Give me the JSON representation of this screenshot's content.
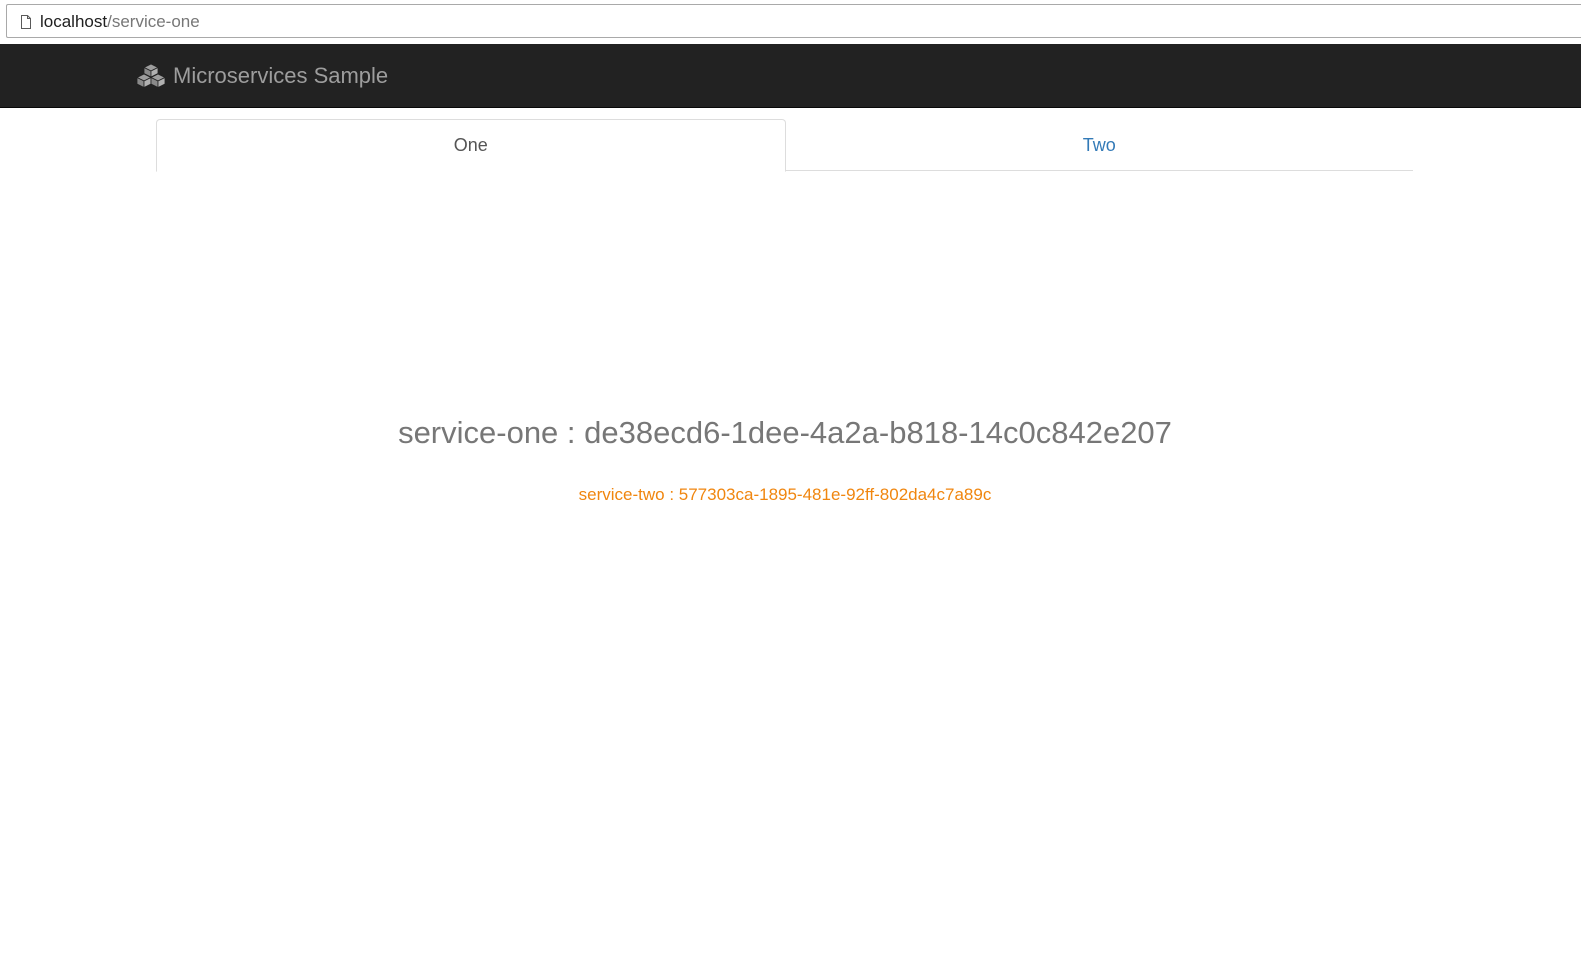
{
  "browser": {
    "url_host": "localhost",
    "url_path": "/service-one",
    "page_icon": "page-icon"
  },
  "navbar": {
    "brand_icon": "cubes-icon",
    "brand": "Microservices Sample",
    "background": "#222222"
  },
  "tabs": [
    {
      "label": "One",
      "active": true
    },
    {
      "label": "Two",
      "active": false
    }
  ],
  "content": {
    "service_one": "service-one : de38ecd6-1dee-4a2a-b818-14c0c842e207",
    "service_two": "service-two : 577303ca-1895-481e-92ff-802da4c7a89c",
    "service_two_color": "#f0860f"
  }
}
